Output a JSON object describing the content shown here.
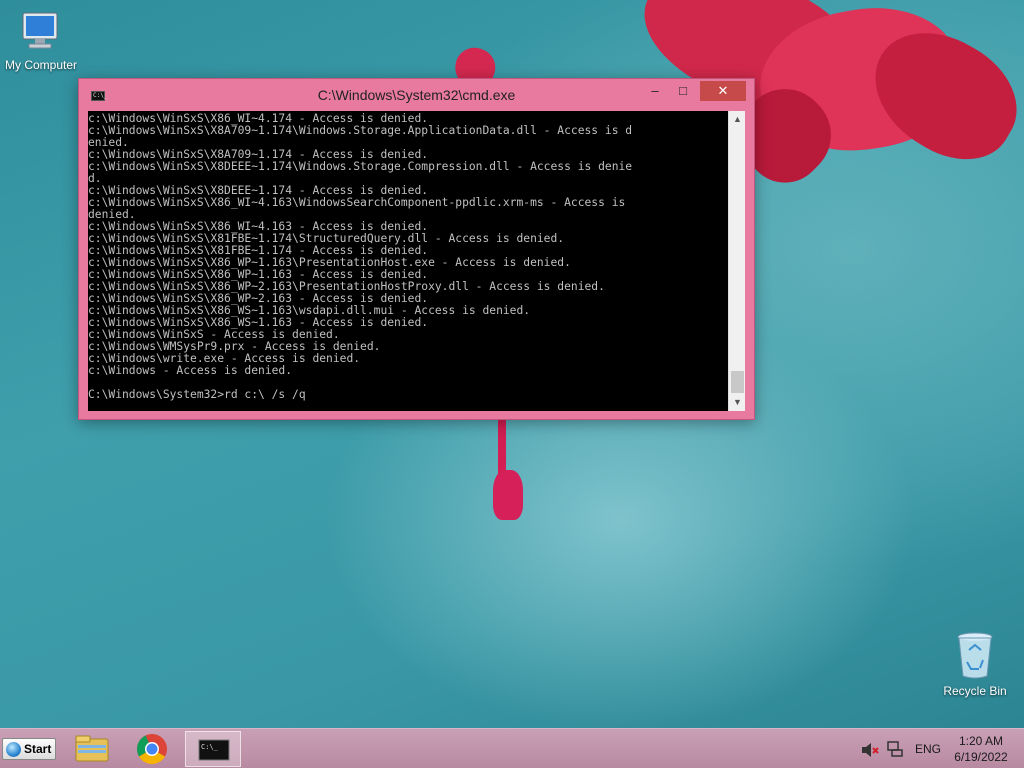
{
  "desktop": {
    "icons": [
      {
        "label": "My Computer"
      },
      {
        "label": "Recycle Bin"
      }
    ]
  },
  "window": {
    "title": "C:\\Windows\\System32\\cmd.exe",
    "controls": {
      "minimize": "–",
      "maximize": "□",
      "close": "✕"
    },
    "console_lines": [
      "c:\\Windows\\WinSxS\\X86_WI~4.174 - Access is denied.",
      "c:\\Windows\\WinSxS\\X8A709~1.174\\Windows.Storage.ApplicationData.dll - Access is d",
      "enied.",
      "c:\\Windows\\WinSxS\\X8A709~1.174 - Access is denied.",
      "c:\\Windows\\WinSxS\\X8DEEE~1.174\\Windows.Storage.Compression.dll - Access is denie",
      "d.",
      "c:\\Windows\\WinSxS\\X8DEEE~1.174 - Access is denied.",
      "c:\\Windows\\WinSxS\\X86_WI~4.163\\WindowsSearchComponent-ppdlic.xrm-ms - Access is",
      "denied.",
      "c:\\Windows\\WinSxS\\X86_WI~4.163 - Access is denied.",
      "c:\\Windows\\WinSxS\\X81FBE~1.174\\StructuredQuery.dll - Access is denied.",
      "c:\\Windows\\WinSxS\\X81FBE~1.174 - Access is denied.",
      "c:\\Windows\\WinSxS\\X86_WP~1.163\\PresentationHost.exe - Access is denied.",
      "c:\\Windows\\WinSxS\\X86_WP~1.163 - Access is denied.",
      "c:\\Windows\\WinSxS\\X86_WP~2.163\\PresentationHostProxy.dll - Access is denied.",
      "c:\\Windows\\WinSxS\\X86_WP~2.163 - Access is denied.",
      "c:\\Windows\\WinSxS\\X86_WS~1.163\\wsdapi.dll.mui - Access is denied.",
      "c:\\Windows\\WinSxS\\X86_WS~1.163 - Access is denied.",
      "c:\\Windows\\WinSxS - Access is denied.",
      "c:\\Windows\\WMSysPr9.prx - Access is denied.",
      "c:\\Windows\\write.exe - Access is denied.",
      "c:\\Windows - Access is denied.",
      "",
      "C:\\Windows\\System32>rd c:\\ /s /q"
    ]
  },
  "taskbar": {
    "start_label": "Start",
    "items": [
      {
        "icon": "file-explorer-icon"
      },
      {
        "icon": "chrome-icon"
      },
      {
        "icon": "cmd-icon",
        "active": true
      }
    ],
    "tray": {
      "language": "ENG",
      "time": "1:20 AM",
      "date": "6/19/2022"
    }
  },
  "colors": {
    "window_frame": "#e87aa0",
    "close_button": "#c74a4a",
    "console_bg": "#000000",
    "console_text": "#c0c0c0"
  }
}
